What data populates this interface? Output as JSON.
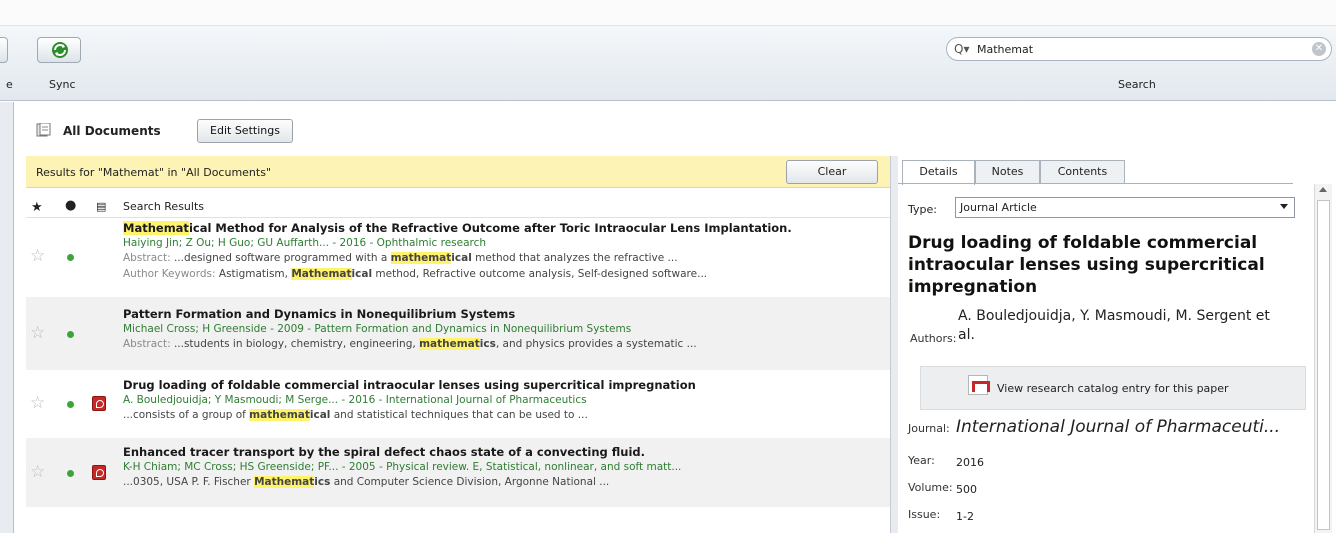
{
  "toolbar": {
    "partial_label": "e",
    "sync_label": "Sync",
    "search_label": "Search",
    "search_value": "Mathemat"
  },
  "collection": {
    "name": "All Documents",
    "edit_settings": "Edit Settings"
  },
  "results_bar": {
    "text": "Results for \"Mathemat\" in \"All Documents\"",
    "clear": "Clear"
  },
  "list": {
    "column_title": "Search Results",
    "rows": [
      {
        "title_hl": "Mathemat",
        "title_rest": "ical Method for Analysis of the Refractive Outcome after Toric Intraocular Lens Implantation.",
        "meta": "Haiying Jin; Z Ou; H Guo; GU Auffarth... - 2016 - Ophthalmic research",
        "abstract_label": "Abstract: ",
        "abstract_pre": "...designed software programmed with a ",
        "abstract_hl": "mathemat",
        "abstract_hl_rest": "ical",
        "abstract_post": " method that analyzes the refractive ...",
        "kw_label": "Author Keywords: ",
        "kw_pre": "Astigmatism, ",
        "kw_hl": "Mathemat",
        "kw_hl_rest": "ical",
        "kw_post": " method, Refractive outcome analysis, Self-designed software..."
      },
      {
        "title": "Pattern Formation and Dynamics in Nonequilibrium Systems",
        "meta": "Michael Cross; H Greenside - 2009 - Pattern Formation and Dynamics in Nonequilibrium Systems",
        "abstract_label": "Abstract: ",
        "abstract_pre": "...students in biology, chemistry, engineering, ",
        "abstract_hl": "mathemat",
        "abstract_hl_rest": "ics",
        "abstract_post": ", and physics provides a systematic ..."
      },
      {
        "title": "Drug loading of foldable commercial intraocular lenses using supercritical impregnation",
        "meta": "A. Bouledjouidja; Y Masmoudi; M Serge... - 2016 - International Journal of Pharmaceutics",
        "snippet_pre": "...consists of a group of ",
        "snippet_hl": "mathemat",
        "snippet_hl_rest": "ical",
        "snippet_post": " and statistical techniques that can be used to ..."
      },
      {
        "title": "Enhanced tracer transport by the spiral defect chaos state of a convecting fluid.",
        "meta": "K-H Chiam; MC Cross; HS Greenside; PF... - 2005 - Physical review. E, Statistical, nonlinear, and soft matt...",
        "snippet_pre": "...0305, USA P. F. Fischer ",
        "snippet_hl": "Mathemat",
        "snippet_hl_rest": "ics",
        "snippet_post": " and Computer Science Division, Argonne National ..."
      }
    ]
  },
  "details": {
    "tabs": [
      "Details",
      "Notes",
      "Contents"
    ],
    "type_label": "Type:",
    "type_value": "Journal Article",
    "title": "Drug loading of foldable commercial intraocular lenses using supercritical impregnation",
    "authors_label": "Authors:",
    "authors_value": "A. Bouledjouidja, Y. Masmoudi, M. Sergent et al.",
    "catalog_text": "View research catalog entry for this paper",
    "journal_label": "Journal:",
    "journal_value": "International Journal of Pharmaceuti...",
    "year_label": "Year:",
    "year_value": "2016",
    "volume_label": "Volume:",
    "volume_value": "500",
    "issue_label": "Issue:",
    "issue_value": "1-2"
  }
}
